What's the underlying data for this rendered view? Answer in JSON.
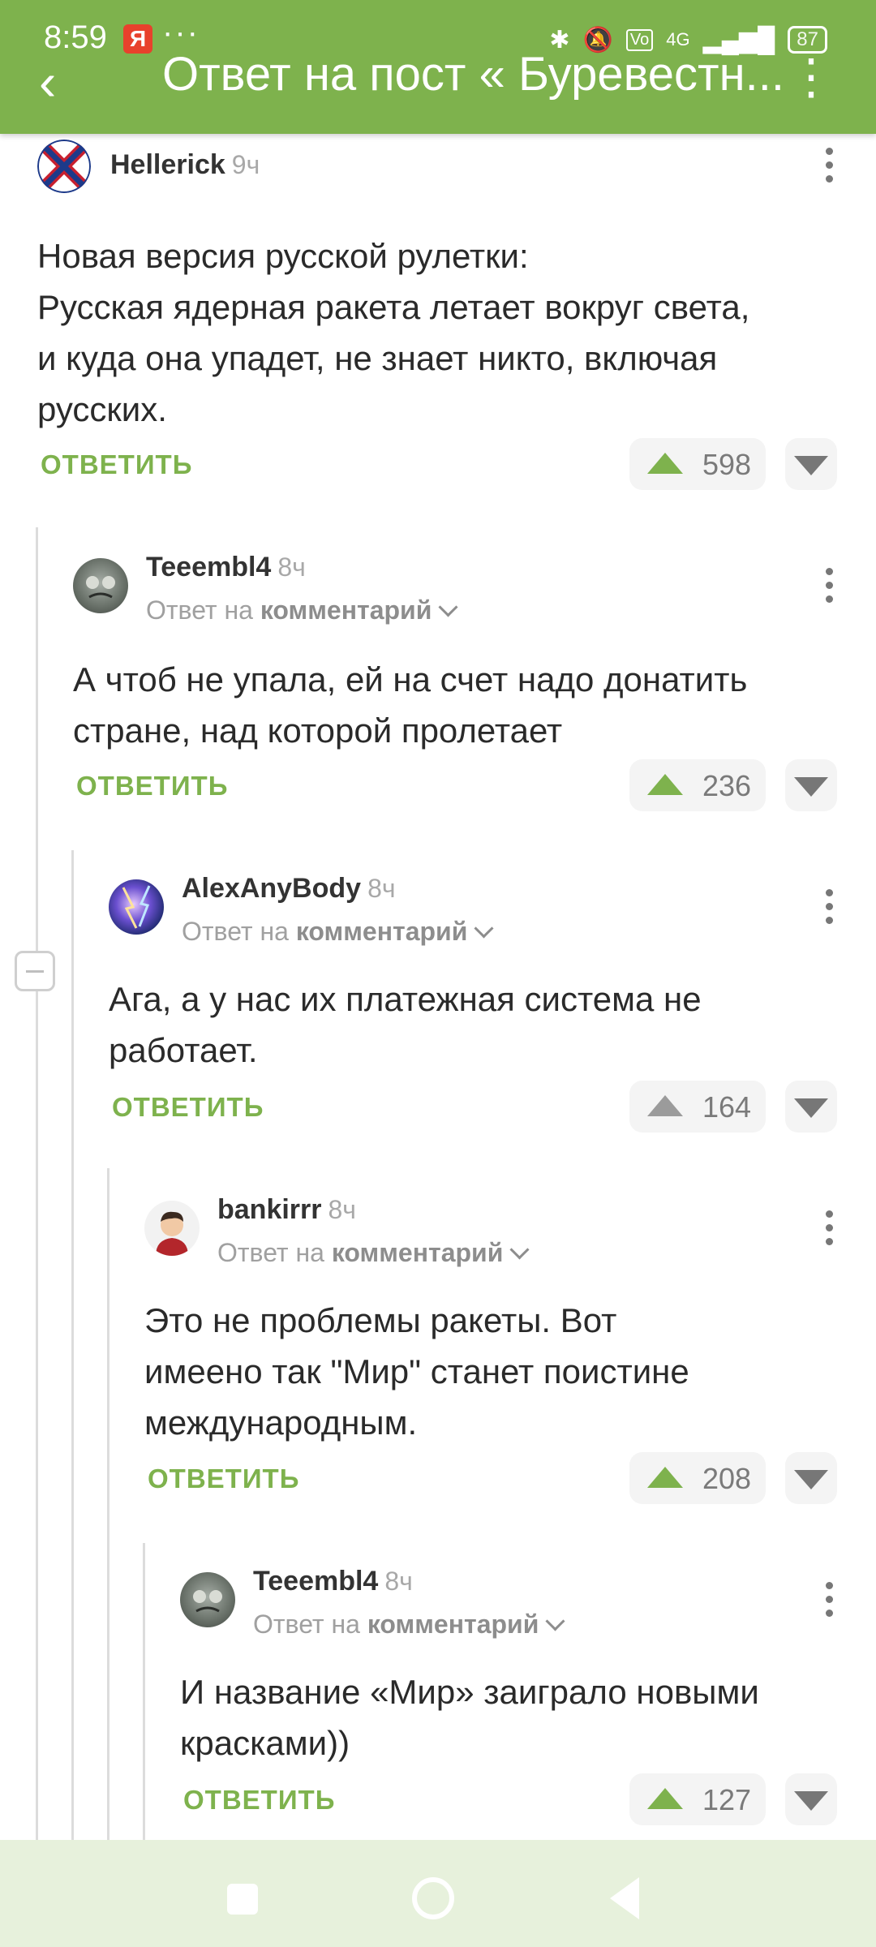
{
  "status": {
    "time": "8:59",
    "yandex": "Я",
    "more": "···",
    "battery": "87",
    "network": "4G"
  },
  "header": {
    "title": "Ответ на пост « Буревестн..."
  },
  "comments": [
    {
      "author": "Hellerick",
      "time": "9ч",
      "text": "Новая версия русской рулетки:\nРусская ядерная ракета летает вокруг света,\nи куда она упадет, не знает никто, включая\nрусских.",
      "reply_label": "ОТВЕТИТЬ",
      "votes": "598"
    },
    {
      "author": "Teeembl4",
      "time": "8ч",
      "reply_prefix": "Ответ на",
      "reply_target": "комментарий",
      "text": "А чтоб не упала, ей на счет надо донатить\nстране, над которой пролетает",
      "reply_label": "ОТВЕТИТЬ",
      "votes": "236"
    },
    {
      "author": "AlexAnyBody",
      "time": "8ч",
      "reply_prefix": "Ответ на",
      "reply_target": "комментарий",
      "text": "Ага, а у нас их платежная система не\nработает.",
      "reply_label": "ОТВЕТИТЬ",
      "votes": "164"
    },
    {
      "author": "bankirrr",
      "time": "8ч",
      "reply_prefix": "Ответ на",
      "reply_target": "комментарий",
      "text": "Это не проблемы ракеты. Вот\nимеено так \"Мир\" станет поистине\nмеждународным.",
      "reply_label": "ОТВЕТИТЬ",
      "votes": "208"
    },
    {
      "author": "Teeembl4",
      "time": "8ч",
      "reply_prefix": "Ответ на",
      "reply_target": "комментарий",
      "text": "И название «Мир» заиграло новыми\nкрасками))",
      "reply_label": "ОТВЕТИТЬ",
      "votes": "127"
    }
  ],
  "colors": {
    "accent": "#7eb24d",
    "nav_bg": "#e7f1dc"
  }
}
